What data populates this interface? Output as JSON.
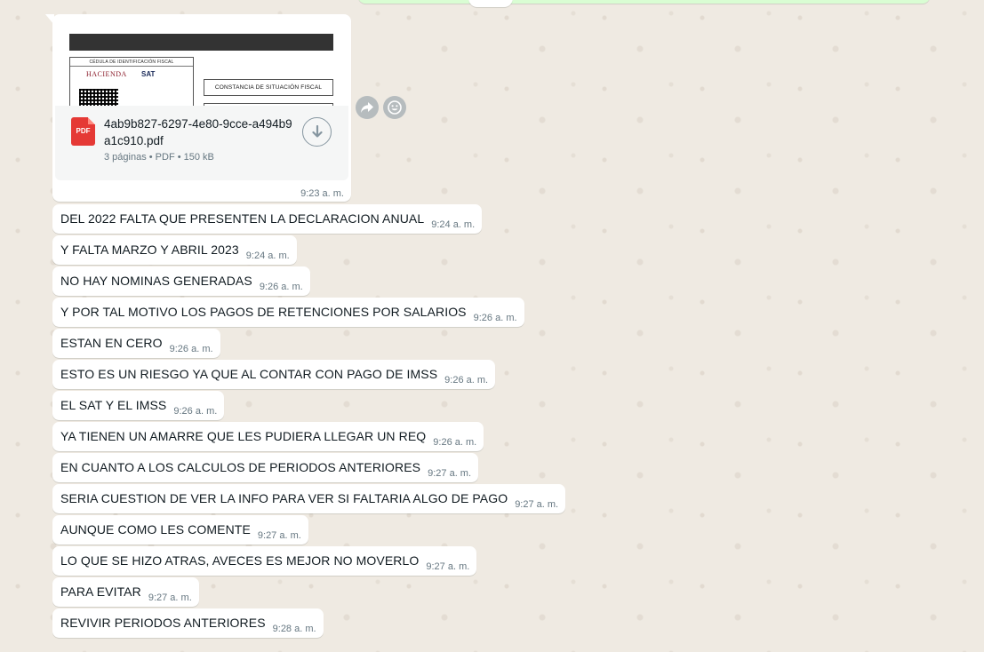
{
  "document_message": {
    "preview": {
      "cedula_title": "CÉDULA DE IDENTIFICACIÓN FISCAL",
      "hacienda_label": "HACIENDA",
      "sat_label": "SAT",
      "constancia_label": "CONSTANCIA DE SITUACIÓN FISCAL"
    },
    "file_name": "4ab9b827-6297-4e80-9cce-a494b9a1c910.pdf",
    "file_meta": "3 páginas • PDF • 150 kB",
    "file_type_label": "PDF",
    "time": "9:23 a. m."
  },
  "icons": {
    "forward": "forward-icon",
    "emoji": "emoji-icon",
    "download": "download-icon",
    "pdf": "pdf-icon"
  },
  "messages": [
    {
      "text": "DEL 2022 FALTA QUE PRESENTEN LA DECLARACION ANUAL",
      "time": "9:24 a. m."
    },
    {
      "text": "Y FALTA MARZO Y ABRIL 2023",
      "time": "9:24 a. m."
    },
    {
      "text": "NO HAY NOMINAS GENERADAS",
      "time": "9:26 a. m."
    },
    {
      "text": "Y POR TAL MOTIVO LOS PAGOS DE RETENCIONES POR SALARIOS",
      "time": "9:26 a. m."
    },
    {
      "text": "ESTAN EN CERO",
      "time": "9:26 a. m."
    },
    {
      "text": "ESTO ES UN RIESGO YA QUE AL CONTAR CON PAGO DE IMSS",
      "time": "9:26 a. m."
    },
    {
      "text": "EL SAT Y EL IMSS",
      "time": "9:26 a. m."
    },
    {
      "text": "YA TIENEN UN AMARRE QUE LES PUDIERA LLEGAR UN REQ",
      "time": "9:26 a. m."
    },
    {
      "text": "EN CUANTO A LOS CALCULOS DE PERIODOS ANTERIORES",
      "time": "9:27 a. m."
    },
    {
      "text": "SERIA CUESTION DE VER LA INFO PARA VER SI FALTARIA ALGO DE PAGO",
      "time": "9:27 a. m."
    },
    {
      "text": "AUNQUE COMO LES COMENTE",
      "time": "9:27 a. m."
    },
    {
      "text": "LO QUE SE HIZO ATRAS, AVECES ES MEJOR NO MOVERLO",
      "time": "9:27 a. m."
    },
    {
      "text": "PARA EVITAR",
      "time": "9:27 a. m."
    },
    {
      "text": "REVIVIR PERIODOS ANTERIORES",
      "time": "9:28 a. m."
    }
  ],
  "colors": {
    "chat_background": "#efeae2",
    "incoming_bubble": "#ffffff",
    "outgoing_bubble": "#d9fdd3",
    "pdf_red": "#e53935",
    "meta_gray": "#667781"
  }
}
